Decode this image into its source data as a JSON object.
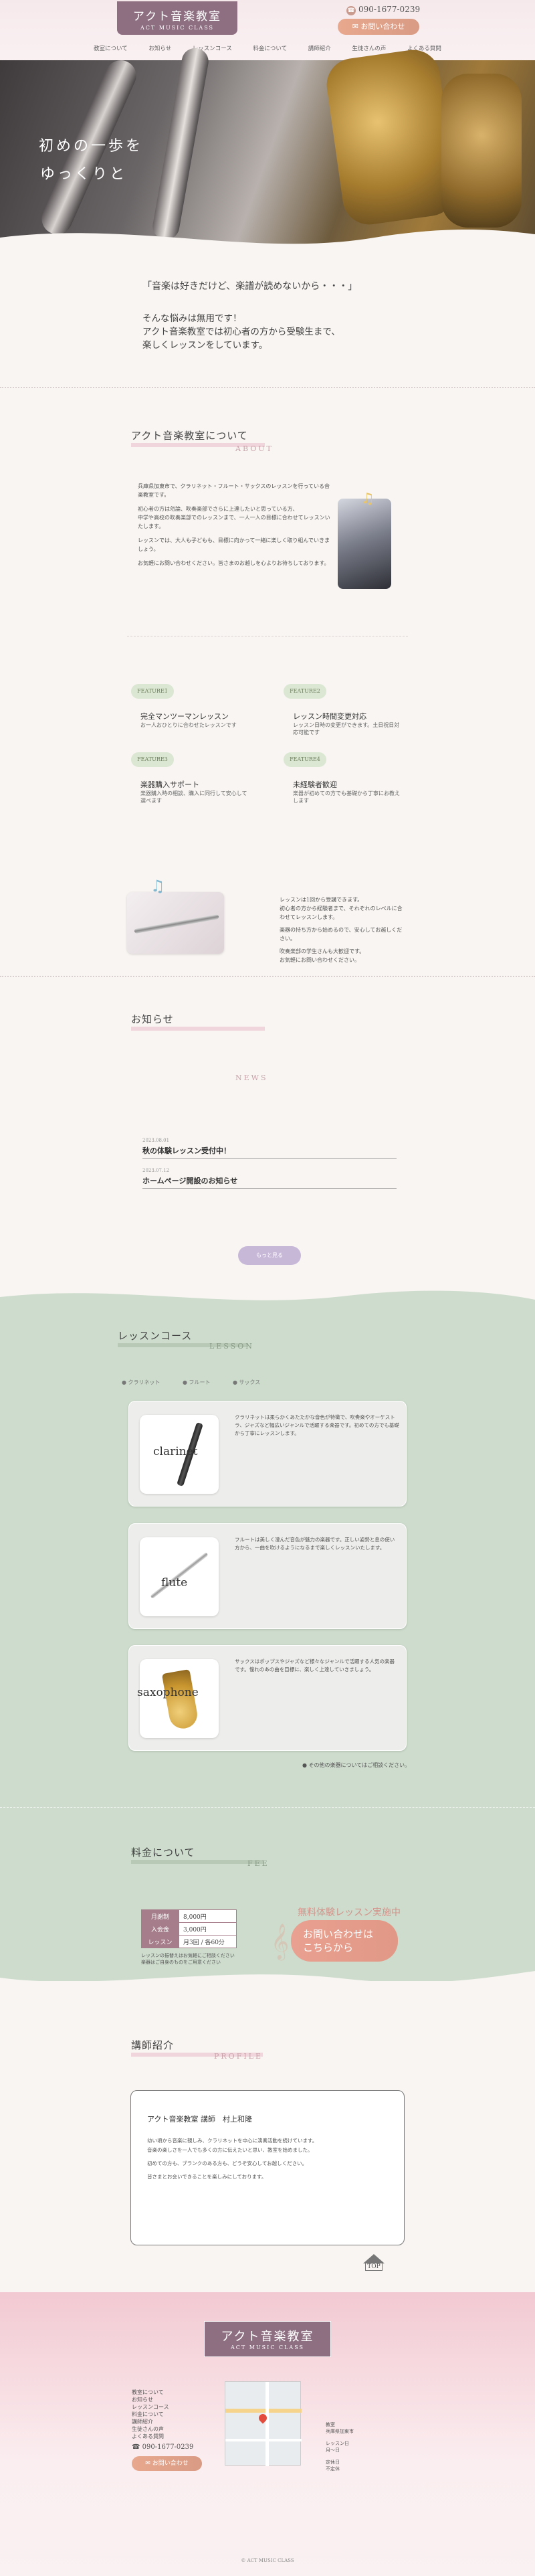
{
  "header": {
    "logo_title": "アクト音楽教室",
    "logo_sub": "ACT MUSIC CLASS",
    "tel": "090-1677-0239",
    "contact_label": "お問い合わせ"
  },
  "nav": [
    "教室について",
    "お知らせ",
    "レッスンコース",
    "料金について",
    "講師紹介",
    "生徒さんの声",
    "よくある質問"
  ],
  "hero": {
    "line1": "初めの一歩を",
    "line2": "ゆっくりと"
  },
  "intro": {
    "quote": "「音楽は好きだけど、楽譜が読めないから・・・」",
    "lines": [
      "そんな悩みは無用です！",
      "アクト音楽教室では初心者の方から受験生まで、",
      "楽しくレッスンをしています。"
    ]
  },
  "about": {
    "title": "アクト音楽教室について",
    "sub": "ABOUT",
    "paragraphs": [
      "兵庫県加東市で、クラリネット・フルート・サックスのレッスンを行っている音楽教室です。",
      "初心者の方は勿論、吹奏楽部でさらに上達したいと思っている方、",
      "中学や高校の吹奏楽部でのレッスンまで、一人一人の目標に合わせてレッスンいたします。",
      "レッスンでは、大人も子どもも、目標に向かって一緒に楽しく取り組んでいきましょう。",
      "お気軽にお問い合わせください。皆さまのお越しを心よりお待ちしております。"
    ]
  },
  "features": [
    {
      "badge": "FEATURE1",
      "head": "完全マンツーマンレッスン",
      "desc": "お一人おひとりに合わせたレッスンです"
    },
    {
      "badge": "FEATURE2",
      "head": "レッスン時間変更対応",
      "desc": "レッスン日時の変更ができます。土日祝日対応可能です"
    },
    {
      "badge": "FEATURE3",
      "head": "楽器購入サポート",
      "desc": "楽器購入時の相談、購入に同行して安心して選べます"
    },
    {
      "badge": "FEATURE4",
      "head": "未経験者歓迎",
      "desc": "楽器が初めての方でも基礎から丁寧にお教えします"
    }
  ],
  "promo_text": [
    "レッスンは1回から受講できます。",
    "初心者の方から経験者まで、それぞれのレベルに合わせてレッスンします。",
    "楽器の持ち方から始めるので、安心してお越しください。",
    "吹奏楽部の学生さんも大歓迎です。",
    "お気軽にお問い合わせください。"
  ],
  "news": {
    "title": "お知らせ",
    "sub": "NEWS",
    "items": [
      {
        "date": "2023.08.01",
        "title": "秋の体験レッスン受付中！"
      },
      {
        "date": "2023.07.12",
        "title": "ホームページ開設のお知らせ"
      }
    ],
    "more": "もっと見る"
  },
  "lesson": {
    "title": "レッスンコース",
    "sub": "LESSON",
    "tabs": [
      "クラリネット",
      "フルート",
      "サックス"
    ],
    "courses": [
      {
        "label": "clarinet",
        "text": "クラリネットは柔らかくあたたかな音色が特徴で、吹奏楽やオーケストラ、ジャズなど幅広いジャンルで活躍する楽器です。初めての方でも基礎から丁寧にレッスンします。"
      },
      {
        "label": "flute",
        "text": "フルートは美しく澄んだ音色が魅力の楽器です。正しい姿勢と息の使い方から、一曲を吹けるようになるまで楽しくレッスンいたします。"
      },
      {
        "label": "saxophone",
        "text": "サックスはポップスやジャズなど様々なジャンルで活躍する人気の楽器です。憧れのあの曲を目標に、楽しく上達していきましょう。"
      }
    ],
    "note": "その他の楽器についてはご相談ください。"
  },
  "fee": {
    "title": "料金について",
    "sub": "FEE",
    "rows": [
      {
        "h": "月謝制",
        "v": "8,000円"
      },
      {
        "h": "入会金",
        "v": "3,000円"
      },
      {
        "h": "レッスン",
        "v": "月3回 / 各60分"
      }
    ],
    "notes": [
      "レッスンの振替えはお気軽にご相談ください",
      "楽器はご自身のものをご用意ください"
    ],
    "trial_caption": "無料体験レッスン実施中",
    "trial_btn1": "お問い合わせは",
    "trial_btn2": "こちらから"
  },
  "profile": {
    "title": "講師紹介",
    "sub": "PROFILE",
    "name": "アクト音楽教室 講師　村上和隆",
    "paragraphs": [
      "幼い頃から音楽に親しみ、クラリネットを中心に演奏活動を続けています。",
      "音楽の楽しさを一人でも多くの方に伝えたいと思い、教室を始めました。",
      "初めての方も、ブランクのある方も、どうぞ安心してお越しください。",
      "皆さまとお会いできることを楽しみにしております。"
    ]
  },
  "top_label": "TOP",
  "footer": {
    "logo_title": "アクト音楽教室",
    "logo_sub": "ACT MUSIC CLASS",
    "nav": [
      "教室について",
      "お知らせ",
      "レッスンコース",
      "料金について",
      "講師紹介",
      "生徒さんの声",
      "よくある質問"
    ],
    "tel": "090-1677-0239",
    "contact_label": "お問い合わせ",
    "info": [
      "教室",
      "兵庫県加東市",
      "",
      "レッスン日",
      "月〜日",
      "",
      "定休日",
      "不定休"
    ],
    "copyright": "© ACT MUSIC CLASS"
  },
  "colors": {
    "accent": "#8e6f82",
    "pink": "#f0d6dc",
    "green": "#cddccc",
    "orange": "#e7a88e"
  }
}
